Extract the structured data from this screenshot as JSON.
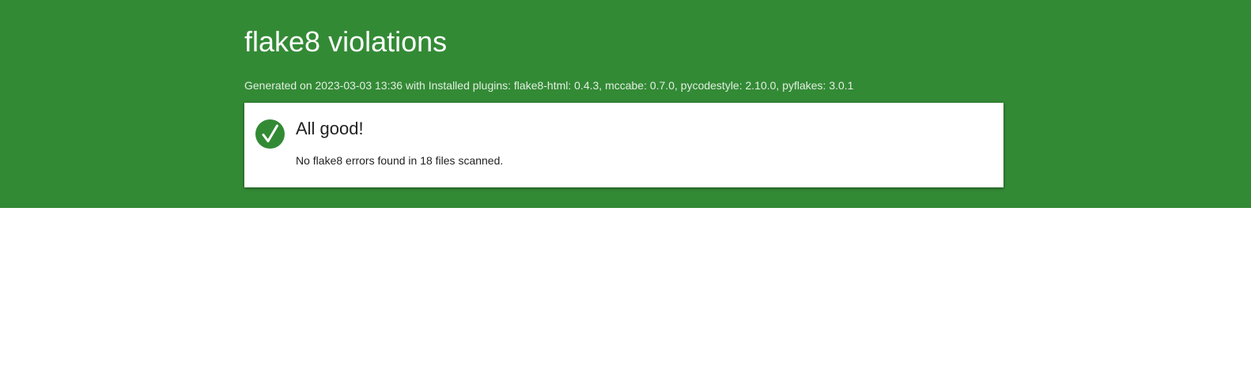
{
  "header": {
    "title": "flake8 violations",
    "subtitle": "Generated on 2023-03-03 13:36 with Installed plugins: flake8-html: 0.4.3, mccabe: 0.7.0, pycodestyle: 2.10.0, pyflakes: 3.0.1",
    "background_color": "#338a35"
  },
  "result": {
    "icon": "checkmark-icon",
    "heading": "All good!",
    "message": "No flake8 errors found in 18 files scanned.",
    "accent_color": "#338a35"
  }
}
